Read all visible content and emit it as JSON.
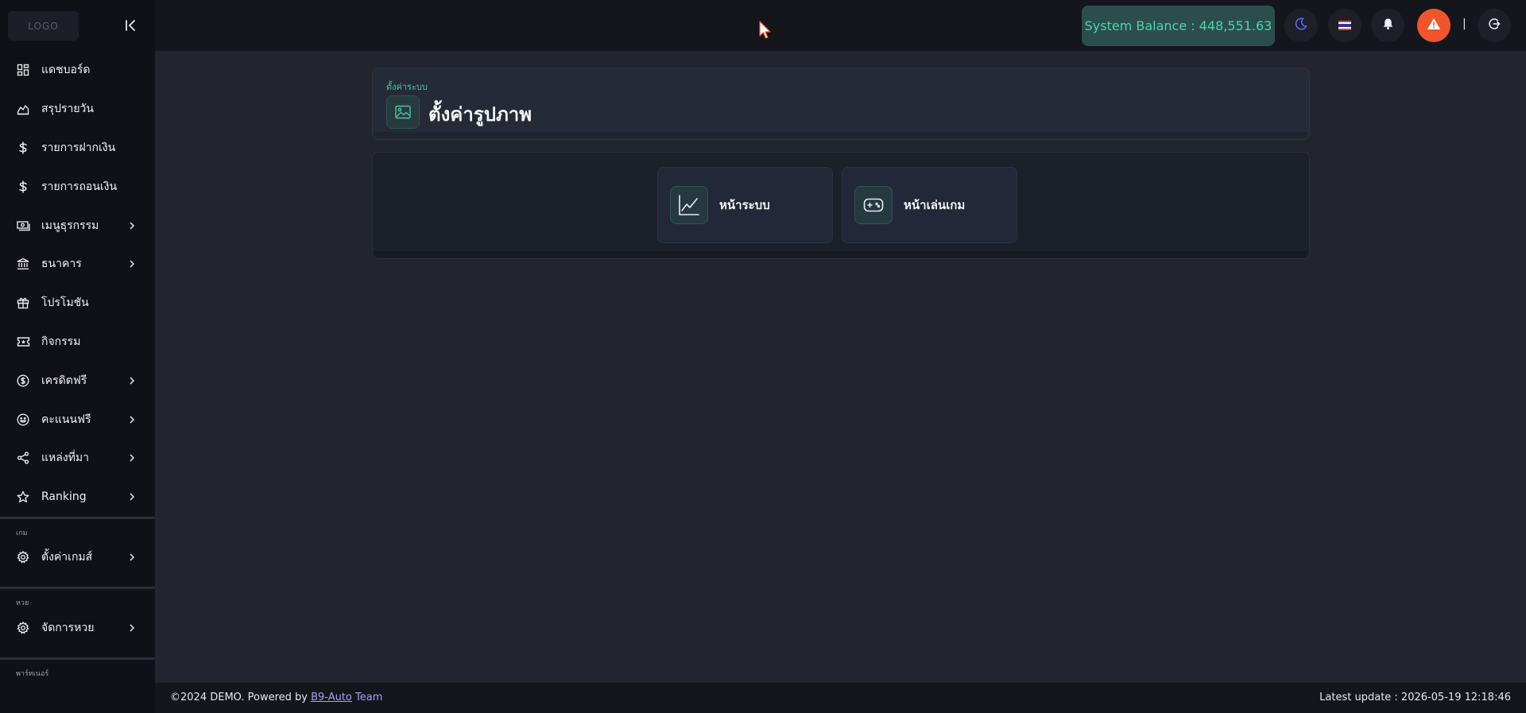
{
  "sidebar": {
    "logo": "LOGO",
    "items": [
      {
        "label": "แดชบอร์ด",
        "icon": "dashboard-icon",
        "chevron": false
      },
      {
        "label": "สรุปรายวัน",
        "icon": "area-chart-icon",
        "chevron": false
      },
      {
        "label": "รายการฝากเงิน",
        "icon": "dollar-icon",
        "chevron": false
      },
      {
        "label": "รายการถอนเงิน",
        "icon": "dollar-icon",
        "chevron": false
      },
      {
        "label": "เมนูธุรกรรม",
        "icon": "cash-icon",
        "chevron": true
      },
      {
        "label": "ธนาคาร",
        "icon": "bank-icon",
        "chevron": true
      },
      {
        "label": "โปรโมชัน",
        "icon": "gift-icon",
        "chevron": false
      },
      {
        "label": "กิจกรรม",
        "icon": "ticket-icon",
        "chevron": false
      },
      {
        "label": "เครดิตฟรี",
        "icon": "coin-icon",
        "chevron": true
      },
      {
        "label": "คะแนนฟรี",
        "icon": "smile-icon",
        "chevron": true
      },
      {
        "label": "แหล่งที่มา",
        "icon": "share-icon",
        "chevron": true
      },
      {
        "label": "Ranking",
        "icon": "star-icon",
        "chevron": true
      }
    ],
    "sections": [
      {
        "title": "เกม",
        "items": [
          {
            "label": "ตั้งค่าเกมส์",
            "icon": "gear-icon",
            "chevron": true
          }
        ]
      },
      {
        "title": "หวย",
        "items": [
          {
            "label": "จัดการหวย",
            "icon": "gear-icon",
            "chevron": true
          }
        ]
      },
      {
        "title": "พาร์ทเนอร์"
      }
    ]
  },
  "topbar": {
    "balance": "System Balance : 448,551.63",
    "separator": "|"
  },
  "header": {
    "breadcrumb": "ตั้งค่าระบบ",
    "title": "ตั้งค่ารูปภาพ"
  },
  "tiles": [
    {
      "label": "หน้าระบบ",
      "icon": "line-chart-icon"
    },
    {
      "label": "หน้าเล่นเกม",
      "icon": "gamepad-icon"
    }
  ],
  "footer": {
    "prefix": "©2024 DEMO. Powered by ",
    "link": "B9-Auto",
    "suffix": " Team",
    "update_label": "Latest update : 2026-05-19 12:18:46"
  },
  "colors": {
    "accent": "#4ed3a9",
    "alert": "#f2552c",
    "link": "#a79ef5"
  }
}
